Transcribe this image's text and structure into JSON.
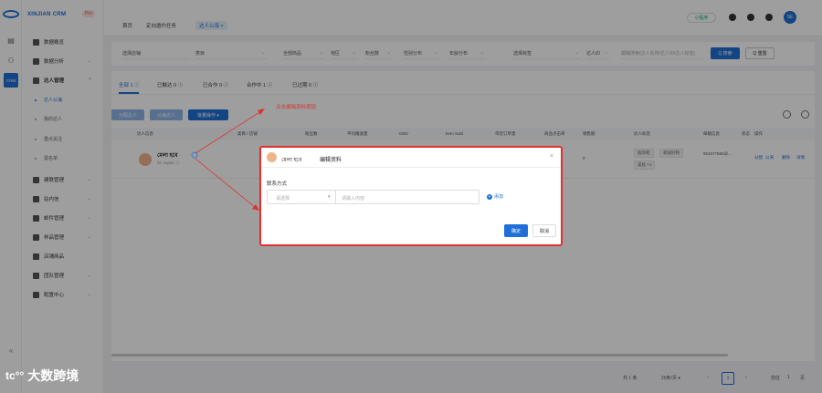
{
  "brand": {
    "name": "XINJIAN CRM",
    "badge": "Pro"
  },
  "rail": {
    "active_label": "CRM"
  },
  "sidebar": {
    "items": [
      {
        "label": "数据概览",
        "chevron": ""
      },
      {
        "label": "数据分析",
        "chevron": "⌄"
      },
      {
        "label": "达人管理",
        "chevron": "^"
      },
      {
        "label": "建联管理",
        "chevron": "⌄"
      },
      {
        "label": "站内信",
        "chevron": "⌄"
      },
      {
        "label": "邮件管理",
        "chevron": "⌄"
      },
      {
        "label": "样品管理",
        "chevron": "⌄"
      },
      {
        "label": "店铺商品",
        "chevron": ""
      },
      {
        "label": "团队管理",
        "chevron": "⌄"
      },
      {
        "label": "配置中心",
        "chevron": "⌄"
      }
    ],
    "sub_items": [
      {
        "label": "达人公海",
        "active": true
      },
      {
        "label": "我的达人",
        "active": false
      },
      {
        "label": "重点关注",
        "active": false
      },
      {
        "label": "黑名单",
        "active": false
      }
    ],
    "collapse": "«"
  },
  "header": {
    "breadcrumbs": [
      "首页",
      "定向邀约任务",
      "达人公海"
    ],
    "active_close": "×",
    "mini_program": "小程序",
    "user_initials": "SE"
  },
  "filters": {
    "selects": [
      "选择店铺",
      "类目",
      "全部商品",
      "地区",
      "粉丝数",
      "性别分布",
      "年龄分布",
      "选择标签",
      "达人ID"
    ],
    "search_placeholder": "模糊搜索(达人名称/达人ID/达人标签)",
    "search_btn": "Q 搜索",
    "reset_btn": "Q 重置"
  },
  "tabs": [
    {
      "label": "全部 1 ⓘ"
    },
    {
      "label": "已触达 0 ⓘ"
    },
    {
      "label": "已合作 0 ⓘ"
    },
    {
      "label": "合作中 1 ⓘ"
    },
    {
      "label": "已过期 0 ⓘ"
    }
  ],
  "actions": {
    "btn1": "分配达人",
    "btn2": "公海达人",
    "btn3": "批量操作 ▾"
  },
  "table": {
    "headers": [
      "达人信息",
      "类目 / 店铺",
      "粉丝数",
      "平均播放量",
      "GMV",
      "Item Sold",
      "带货订单量",
      "商品点击率",
      "销售额",
      "达人标签",
      "邮箱信息",
      "状态",
      "操作"
    ],
    "row": {
      "name": "মেলা হবে",
      "sub": "ID: xqxdc ⓘ",
      "pct": "0",
      "tags": [
        "服饰鞋",
        "家居好物",
        "美妆 +1"
      ],
      "email": "961077560@...",
      "ops": [
        "分配",
        "公海",
        "删除",
        "详情"
      ]
    }
  },
  "pagination": {
    "total": "共 1 条",
    "per_page": "20条/页 ▾",
    "prev": "‹",
    "page": "1",
    "next": "›",
    "goto": "前往",
    "goto_page": "1",
    "suffix": "页"
  },
  "annotation": {
    "label": "点击编辑资料按钮",
    "color": "#e03030"
  },
  "dialog": {
    "name": "মেলা হবে",
    "title": "编辑资料",
    "contact_label": "联系方式",
    "select_placeholder": "请选择",
    "input_placeholder": "请输入内容",
    "add_label": "添加",
    "ok": "确定",
    "cancel": "取消"
  },
  "watermark": {
    "logo": "tc°°",
    "text": "大数跨境"
  },
  "colors": {
    "accent": "#1f6fd6",
    "annotation": "#e03030"
  }
}
